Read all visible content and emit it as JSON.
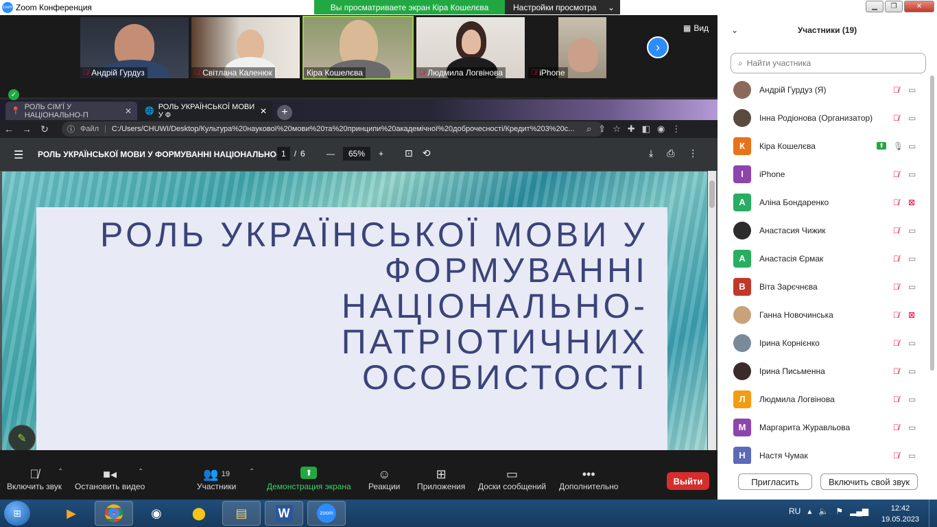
{
  "window": {
    "title": "Zoom Конференция",
    "share_banner": "Вы просматриваете экран Кіра Кошелєва",
    "view_options": "Настройки просмотра"
  },
  "video_strip": {
    "tiles": [
      {
        "name": "Андрій Гурдуз",
        "muted": true
      },
      {
        "name": "Світлана Каленюк",
        "muted": true
      },
      {
        "name": "Кіра Кошелєва",
        "muted": false
      },
      {
        "name": "Людмила Логвінова",
        "muted": true
      },
      {
        "name": "iPhone",
        "muted": true
      }
    ],
    "view_label": "Вид"
  },
  "browser": {
    "tabs": [
      {
        "label": "РОЛЬ СІМ'Ї У НАЦІОНАЛЬНО-П"
      },
      {
        "label": "РОЛЬ УКРАЇНСЬКОЇ МОВИ У Ф"
      }
    ],
    "url_label": "Файл",
    "url": "C:/Users/CHUWI/Desktop/Культура%20наукової%20мови%20та%20принципи%20академічної%20доброчесності/Кредит%203%20c..."
  },
  "pdf": {
    "title": "РОЛЬ УКРАЇНСЬКОЇ МОВИ У ФОРМУВАННІ НАЦІОНАЛЬНО-...",
    "current_page": "1",
    "page_sep": "/",
    "total_pages": "6",
    "zoom": "65%",
    "slide_title_lines": [
      "РОЛЬ УКРАЇНСЬКОЇ МОВИ У",
      "ФОРМУВАННІ",
      "НАЦІОНАЛЬНО-",
      "ПАТРІОТИЧНИХ",
      "ОСОБИСТОСТІ"
    ]
  },
  "toolbar": {
    "unmute": "Включить звук",
    "stop_video": "Остановить видео",
    "participants": "Участники",
    "participants_count": "19",
    "share_screen": "Демонстрация экрана",
    "reactions": "Реакции",
    "apps": "Приложения",
    "whiteboards": "Доски сообщений",
    "more": "Дополнительно",
    "leave": "Выйти"
  },
  "participants_panel": {
    "title": "Участники (19)",
    "search_placeholder": "Найти участника",
    "participants": [
      {
        "name": "Андрій Гурдуз (Я)",
        "avatar": "photo",
        "initial": "",
        "color": "#8a6a5a",
        "mic": "muted",
        "cam": "on"
      },
      {
        "name": "Інна Родіонова (Организатор)",
        "avatar": "photo",
        "initial": "",
        "color": "#5a4a40",
        "mic": "muted",
        "cam": "on"
      },
      {
        "name": "Кіра Кошелєва",
        "avatar": "letter",
        "initial": "К",
        "color": "#e8711a",
        "mic": "on",
        "cam": "on",
        "sharing": true
      },
      {
        "name": "iPhone",
        "avatar": "letter",
        "initial": "I",
        "color": "#8e44ad",
        "mic": "muted",
        "cam": "on"
      },
      {
        "name": "Аліна Бондаренко",
        "avatar": "letter",
        "initial": "А",
        "color": "#27ae60",
        "mic": "muted",
        "cam": "off"
      },
      {
        "name": "Анастасия Чижик",
        "avatar": "photo",
        "initial": "",
        "color": "#2c2c2c",
        "mic": "muted",
        "cam": "on"
      },
      {
        "name": "Анастасія Єрмак",
        "avatar": "letter",
        "initial": "А",
        "color": "#27ae60",
        "mic": "muted",
        "cam": "on"
      },
      {
        "name": "Віта Зарєчнєва",
        "avatar": "letter",
        "initial": "В",
        "color": "#c0392b",
        "mic": "muted",
        "cam": "on"
      },
      {
        "name": "Ганна Новочинська",
        "avatar": "photo",
        "initial": "",
        "color": "#c9a27a",
        "mic": "muted",
        "cam": "off"
      },
      {
        "name": "Ірина Корнієнко",
        "avatar": "photo",
        "initial": "",
        "color": "#7a8a9a",
        "mic": "muted",
        "cam": "on"
      },
      {
        "name": "Ірина Письменна",
        "avatar": "photo",
        "initial": "",
        "color": "#3a2a2a",
        "mic": "muted",
        "cam": "on"
      },
      {
        "name": "Людмила Логвінова",
        "avatar": "letter",
        "initial": "Л",
        "color": "#f39c12",
        "mic": "muted",
        "cam": "on"
      },
      {
        "name": "Маргарита Журавльова",
        "avatar": "letter",
        "initial": "М",
        "color": "#8e44ad",
        "mic": "muted",
        "cam": "on"
      },
      {
        "name": "Настя Чумак",
        "avatar": "letter",
        "initial": "Н",
        "color": "#5b6bb8",
        "mic": "muted",
        "cam": "on"
      }
    ],
    "invite": "Пригласить",
    "unmute_me": "Включить свой звук"
  },
  "taskbar": {
    "lang": "RU",
    "time": "12:42",
    "date": "19.05.2023"
  }
}
